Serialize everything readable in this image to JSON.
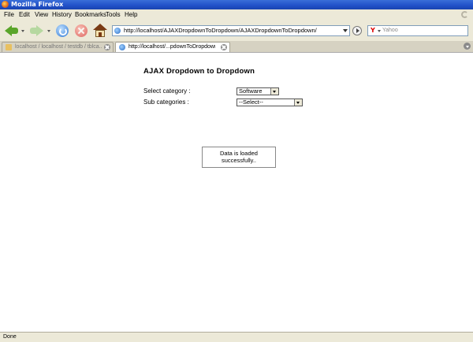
{
  "window": {
    "title": "Mozilla Firefox"
  },
  "menu": [
    "File",
    "Edit",
    "View",
    "History",
    "Bookmarks",
    "Tools",
    "Help"
  ],
  "navbar": {
    "url": "http://localhost/AJAXDropdownToDropdown/AJAXDropdownToDropdown/",
    "search_placeholder": "Yahoo"
  },
  "tabs": [
    {
      "label": "localhost / localhost / testdb / tblca...",
      "active": false
    },
    {
      "label": "http://localhost/...pdownToDropdown/",
      "active": true
    }
  ],
  "page": {
    "title": "AJAX Dropdown to Dropdown",
    "category_label": "Select category :",
    "category_value": "Software",
    "subcategory_label": "Sub categories :",
    "subcategory_value": "--Select--",
    "status_message": "Data is loaded successfully.."
  },
  "statusbar": {
    "text": "Done"
  }
}
